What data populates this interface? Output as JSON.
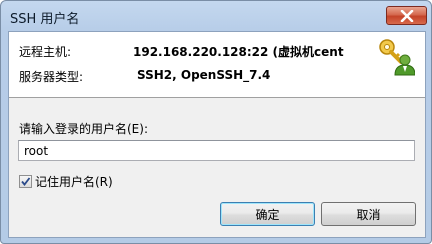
{
  "window": {
    "title": "SSH 用户名",
    "close_icon": "close-icon"
  },
  "info": {
    "host_label": "远程主机:",
    "host_value": "192.168.220.128:22 (虚拟机cent",
    "server_label": "服务器类型:",
    "server_value": "SSH2, OpenSSH_7.4",
    "icon": "key-user-icon"
  },
  "form": {
    "prompt": "请输入登录的用户名(E):",
    "username_value": "root",
    "remember_label": "记住用户名(R)",
    "remember_checked": true
  },
  "buttons": {
    "ok_label": "确定",
    "cancel_label": "取消"
  },
  "colors": {
    "titlebar": "#b7cde8",
    "close_button": "#c44328",
    "dialog_bg": "#f0f0f0",
    "default_button_border": "#3c7fb1"
  }
}
